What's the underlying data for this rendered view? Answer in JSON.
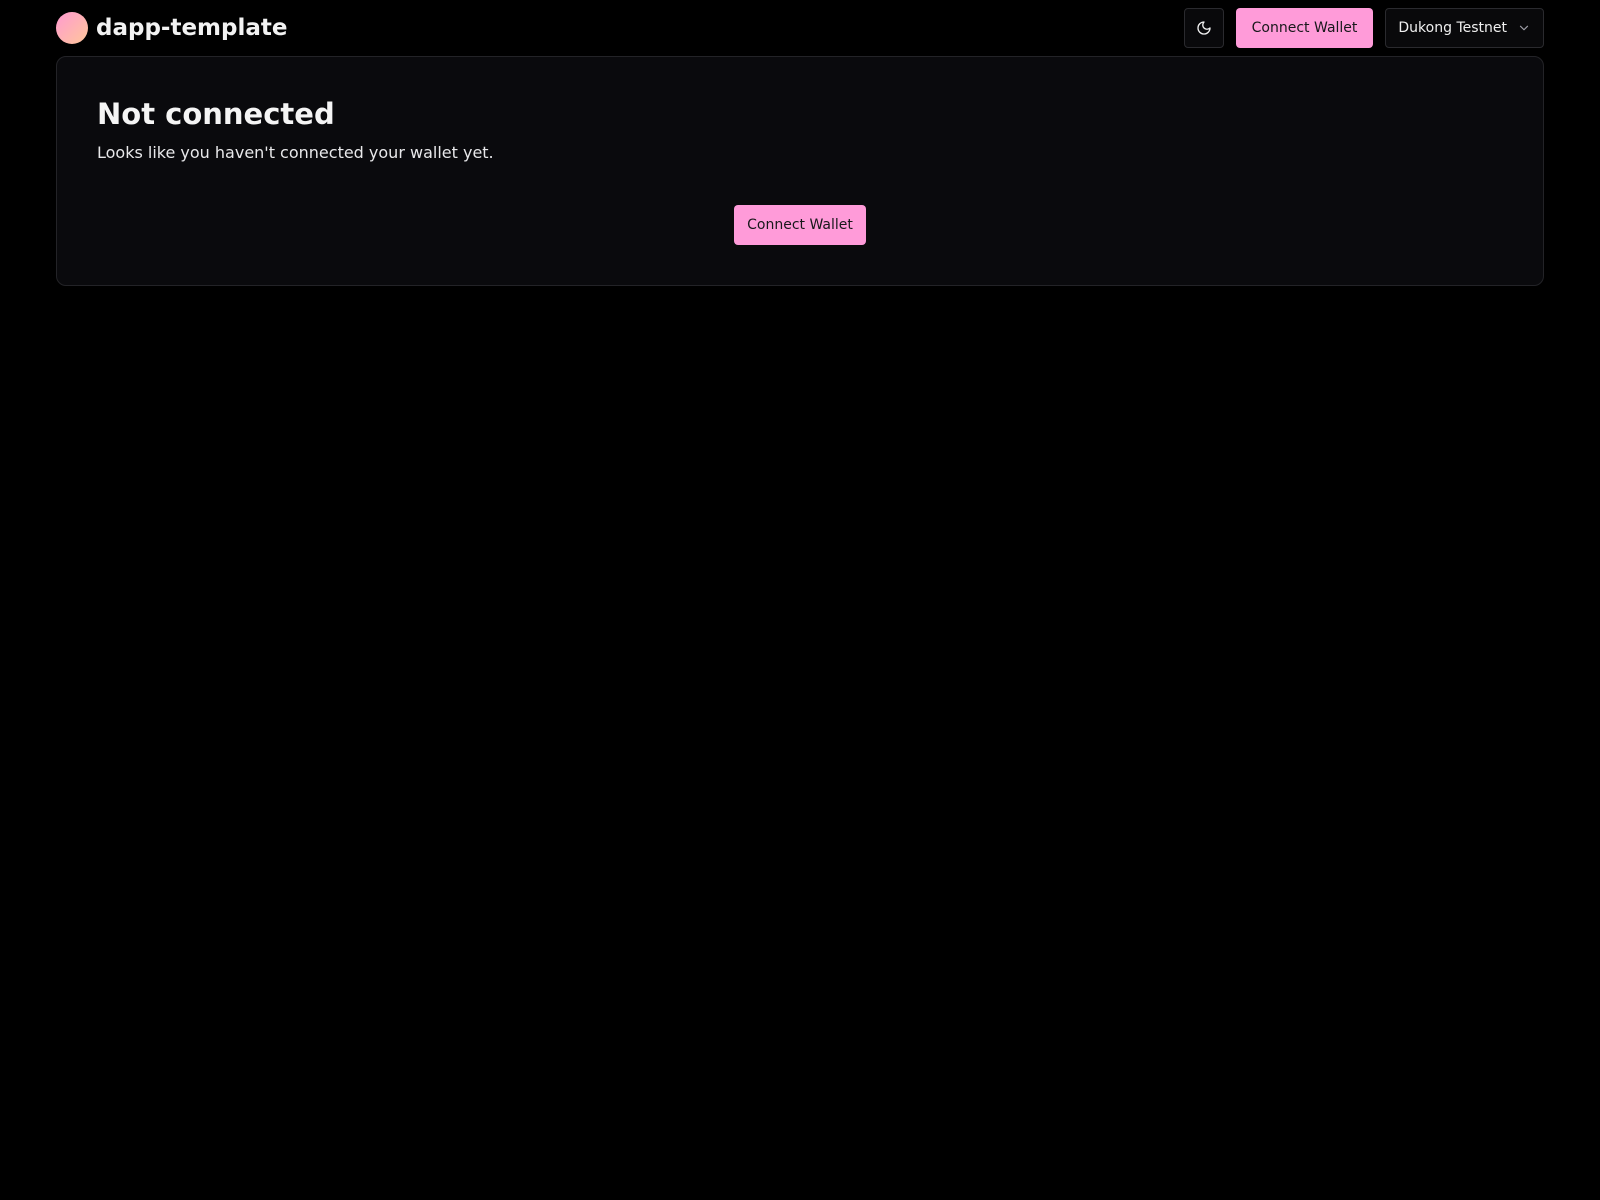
{
  "header": {
    "brand_name": "dapp-template",
    "connect_label": "Connect Wallet",
    "network": {
      "selected": "Dukong Testnet"
    }
  },
  "card": {
    "title": "Not connected",
    "description": "Looks like you haven't connected your wallet yet.",
    "connect_label": "Connect Wallet"
  },
  "icons": {
    "theme_toggle": "moon-icon",
    "network_dropdown": "chevron-down-icon"
  },
  "colors": {
    "accent": "#ff9bd9",
    "background": "#000000",
    "card": "#0a0a0d",
    "border": "#232327"
  }
}
